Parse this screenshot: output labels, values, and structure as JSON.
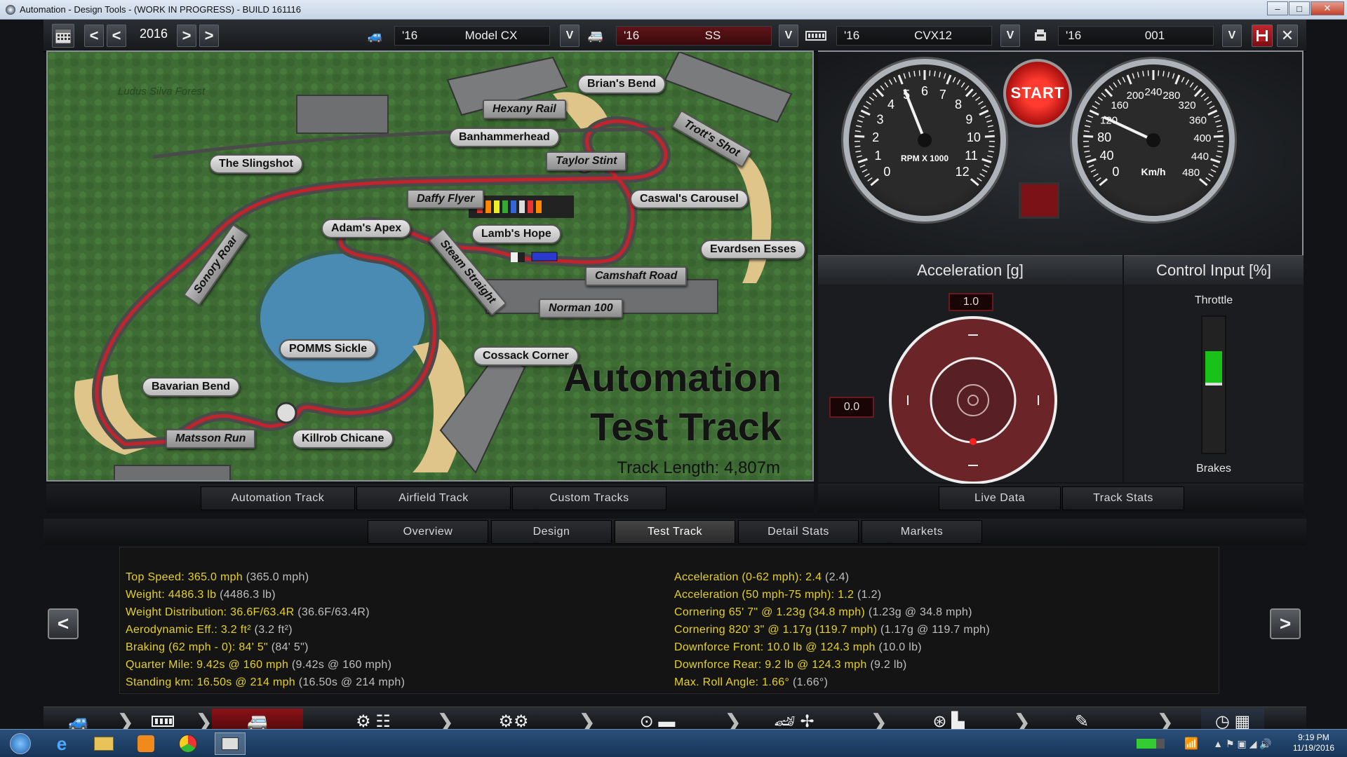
{
  "window": {
    "title": "Automation - Design Tools - (WORK IN PROGRESS) - BUILD 161116",
    "min": "–",
    "max": "□",
    "close": "✕"
  },
  "toolbar": {
    "year": "2016",
    "prev_fast": "<",
    "prev": "<",
    "next": ">",
    "next_fast": ">",
    "model": {
      "year": "'16",
      "name": "Model CX"
    },
    "trim": {
      "year": "'16",
      "name": "SS"
    },
    "engine": {
      "year": "'16",
      "name": "CVX12"
    },
    "variant": {
      "year": "'16",
      "name": "001"
    },
    "dropdown": "V",
    "save_icon": "floppy-icon",
    "close": "✕"
  },
  "map": {
    "forest": "Ludus Silva Forest",
    "title_line1": "Automation",
    "title_line2": "Test Track",
    "length": "Track Length: 4,807m",
    "labels": {
      "brians_bend": "Brian's Bend",
      "hexany_rail": "Hexany Rail",
      "trotts_shot": "Trott's Shot",
      "banhammerhead": "Banhammerhead",
      "taylor_stint": "Taylor Stint",
      "slingshot": "The Slingshot",
      "daffy_flyer": "Daffy Flyer",
      "caswals_carousel": "Caswal's Carousel",
      "adams_apex": "Adam's Apex",
      "lambs_hope": "Lamb's Hope",
      "sonory_roar": "Sonory Roar",
      "steam_straight": "Steam Straight",
      "evardsen_esses": "Evardsen Esses",
      "camshaft_road": "Camshaft Road",
      "norman_100": "Norman 100",
      "pomms_sickle": "POMMS Sickle",
      "cossack_corner": "Cossack Corner",
      "bavarian_bend": "Bavarian Bend",
      "matsson_run": "Matsson Run",
      "killrob_chicane": "Killrob Chicane"
    }
  },
  "gauges": {
    "rpm_label": "RPM X 1000",
    "rpm_ticks": [
      "0",
      "1",
      "2",
      "3",
      "4",
      "5",
      "6",
      "7",
      "8",
      "9",
      "10",
      "11",
      "12"
    ],
    "rpm_value": 5,
    "kmh_label": "Km/h",
    "kmh_ticks": [
      "0",
      "40",
      "80",
      "120",
      "160",
      "200",
      "240",
      "280",
      "320",
      "360",
      "400",
      "440",
      "480"
    ],
    "kmh_value": 120,
    "start": "START"
  },
  "accel": {
    "header": "Acceleration [g]",
    "long_value": "1.0",
    "lat_value": "0.0"
  },
  "control": {
    "header": "Control Input [%]",
    "throttle": "Throttle",
    "brakes": "Brakes",
    "throttle_pct": 0.5,
    "colors": {
      "throttle": "#19c219"
    }
  },
  "track_tabs": [
    "Automation Track",
    "Airfield Track",
    "Custom Tracks"
  ],
  "data_tabs": [
    "Live Data",
    "Track Stats"
  ],
  "main_tabs": {
    "items": [
      "Overview",
      "Design",
      "Test Track",
      "Detail Stats",
      "Markets"
    ],
    "active": "Test Track"
  },
  "stats": {
    "left": [
      {
        "k": "Top Speed: 365.0 mph",
        "v": "(365.0 mph)"
      },
      {
        "k": "Weight: 4486.3 lb",
        "v": "(4486.3 lb)"
      },
      {
        "k": "Weight Distribution: 36.6F/63.4R",
        "v": "(36.6F/63.4R)"
      },
      {
        "k": "Aerodynamic Eff.: 3.2 ft²",
        "v": "(3.2 ft²)"
      },
      {
        "k": "Braking (62 mph - 0): 84' 5\"",
        "v": "(84' 5\")"
      },
      {
        "k": "Quarter Mile: 9.42s @ 160 mph",
        "v": "(9.42s @ 160 mph)"
      },
      {
        "k": "Standing km: 16.50s @ 214 mph",
        "v": "(16.50s @ 214 mph)"
      }
    ],
    "right": [
      {
        "k": "Acceleration (0-62 mph): 2.4",
        "v": "(2.4)"
      },
      {
        "k": "Acceleration (50 mph-75 mph): 1.2",
        "v": "(1.2)"
      },
      {
        "k": "Cornering 65' 7\" @ 1.23g (34.8 mph)",
        "v": "(1.23g @ 34.8 mph)"
      },
      {
        "k": "Cornering 820' 3\" @ 1.17g (119.7 mph)",
        "v": "(1.17g @ 119.7 mph)"
      },
      {
        "k": "Downforce Front: 10.0 lb @ 124.3 mph",
        "v": "(10.0 lb)"
      },
      {
        "k": "Downforce Rear: 9.2 lb @ 124.3 mph",
        "v": "(9.2 lb)"
      },
      {
        "k": "Max. Roll Angle: 1.66°",
        "v": "(1.66°)"
      }
    ]
  },
  "nav": {
    "prev": "<",
    "next": ">"
  },
  "taskbar": {
    "time": "9:19 PM",
    "date": "11/19/2016"
  }
}
